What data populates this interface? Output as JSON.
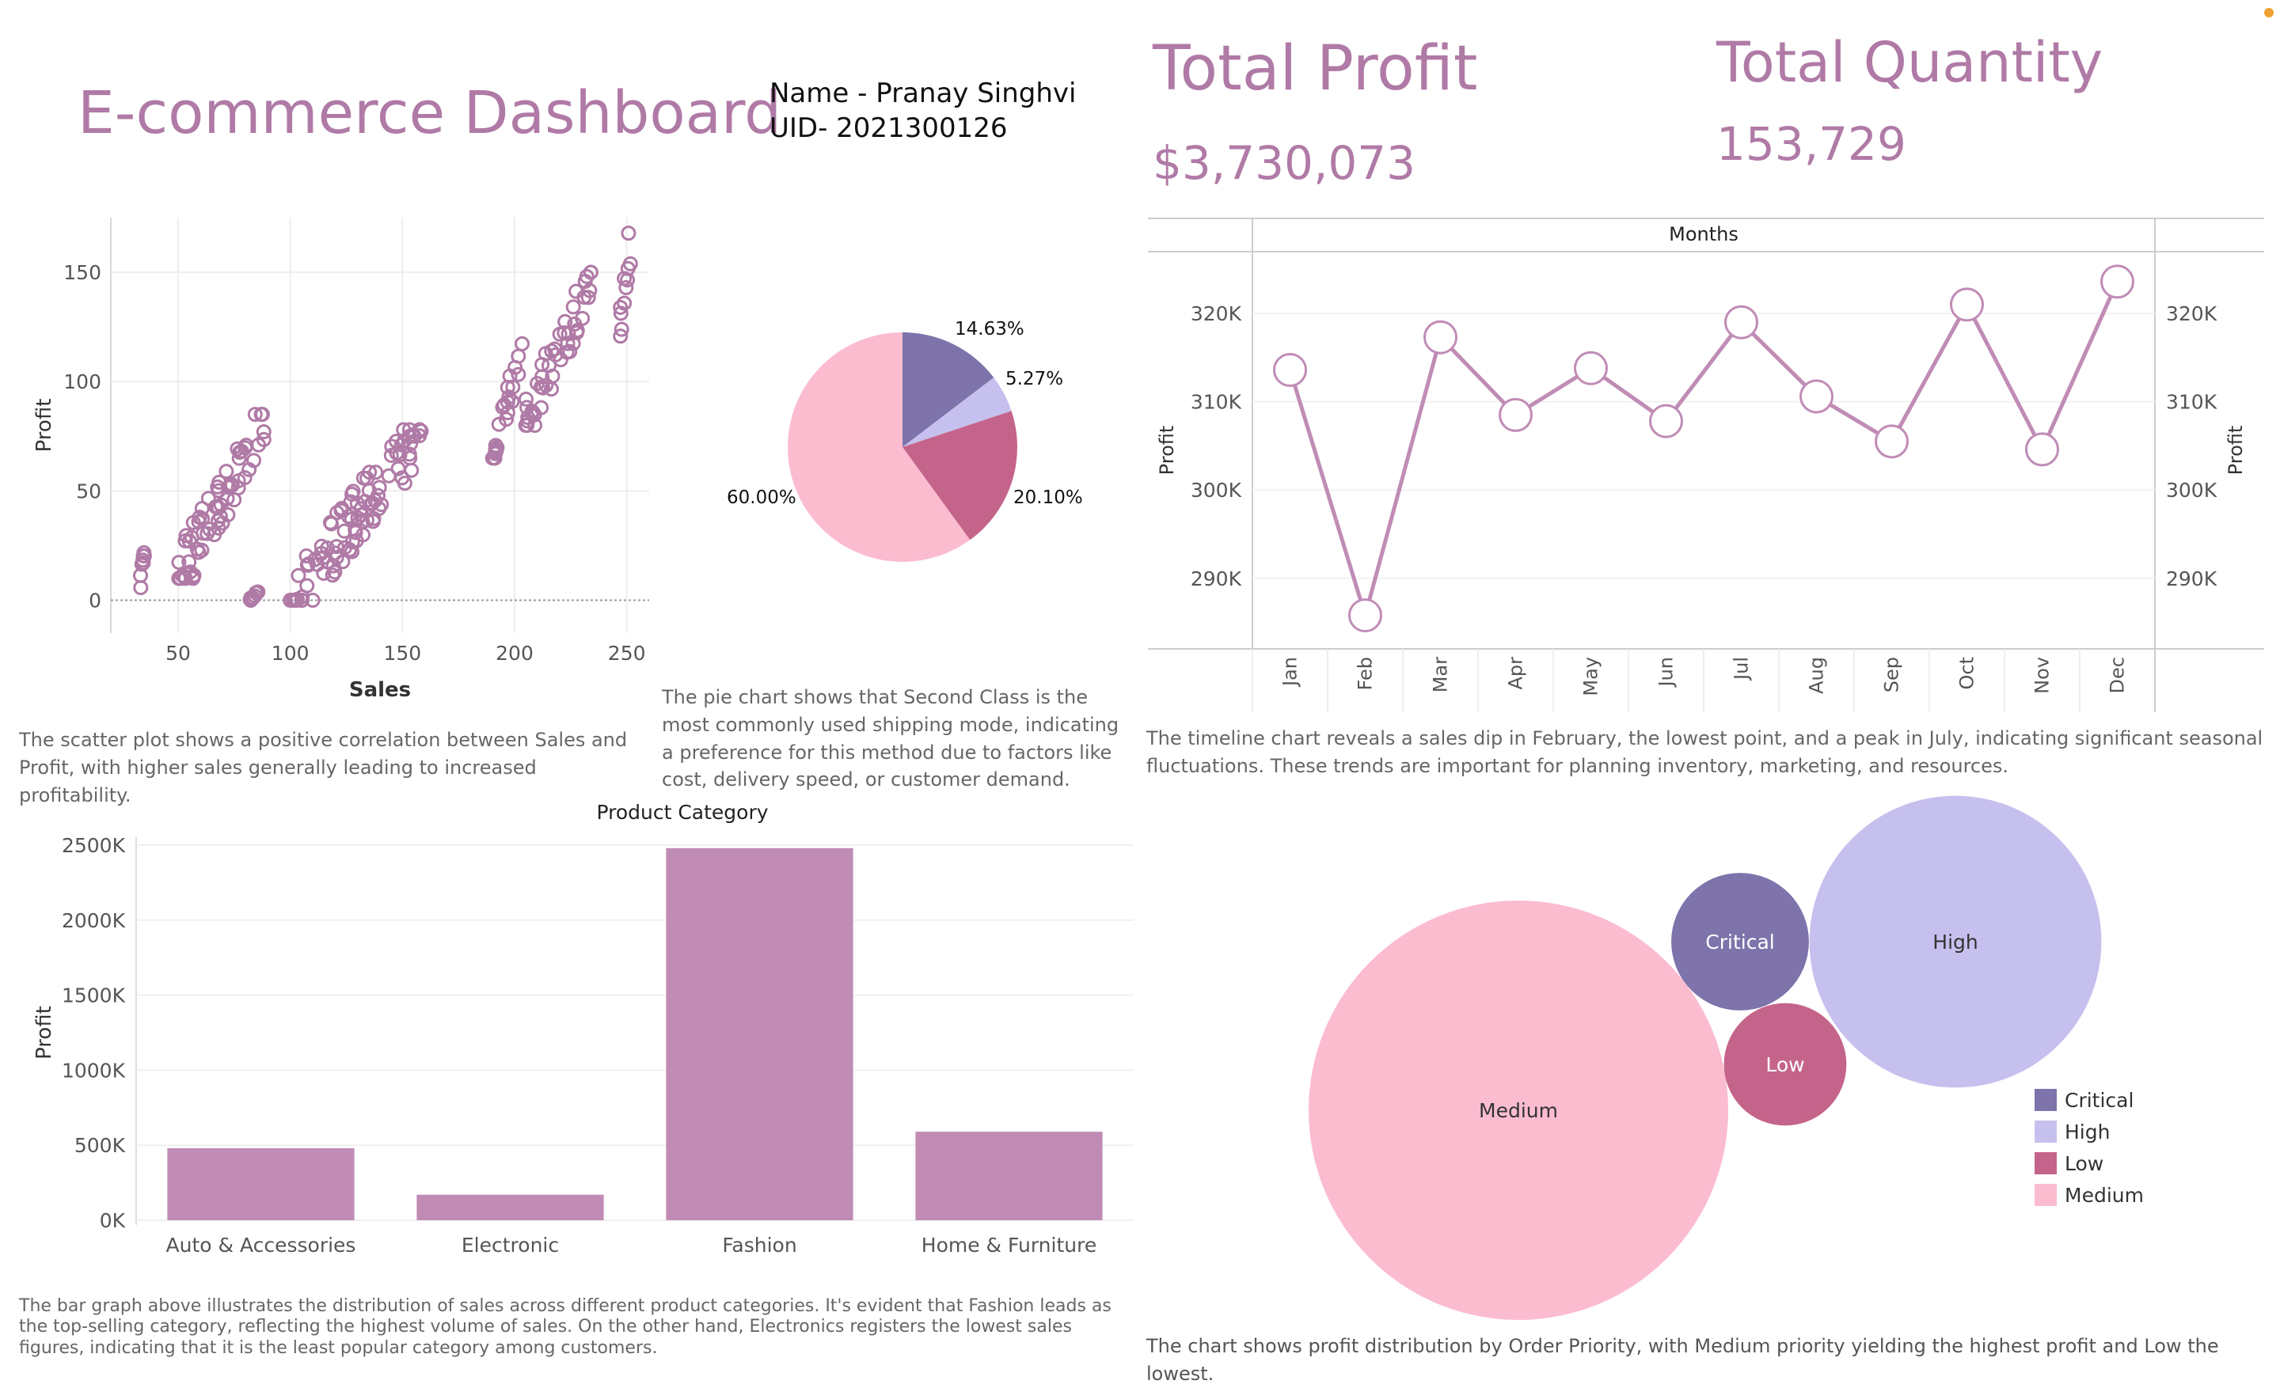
{
  "header": {
    "title": "E-commerce Dashboard",
    "name_line": "Name - Pranay Singhvi",
    "uid_line": "UID- 2021300126"
  },
  "kpis": [
    {
      "label": "Total Profit",
      "value": "$3,730,073"
    },
    {
      "label": "Total Quantity",
      "value": "153,729"
    }
  ],
  "descriptions": {
    "scatter": "The scatter plot shows a positive correlation between Sales and Profit, with higher sales generally leading to increased profitability.",
    "pie": "The pie chart shows that Second Class is the most commonly used shipping mode, indicating a preference for this method due to factors like cost, delivery speed, or customer demand.",
    "line": "The timeline chart reveals a sales dip in February, the lowest point, and a peak in July, indicating significant seasonal fluctuations. These trends are important for planning inventory, marketing, and resources.",
    "bar": "The bar graph above illustrates the distribution of sales across different product categories. It's evident that Fashion leads as the top-selling category, reflecting the highest volume of sales. On the other hand, Electronics registers the lowest sales figures, indicating that it is the least popular category among customers.",
    "bubble": "The chart shows profit distribution by Order Priority, with Medium priority yielding the highest profit and Low the lowest."
  },
  "colors": {
    "accent": "#b07aa6",
    "mark": "#c08cb5",
    "critical": "#7e73ab",
    "high": "#c6c0ee",
    "low": "#c5648a",
    "medium": "#fbbcd0"
  },
  "chart_data": [
    {
      "id": "scatter",
      "type": "scatter",
      "xlabel": "Sales",
      "ylabel": "Profit",
      "xticks": [
        50,
        100,
        150,
        200,
        250
      ],
      "yticks": [
        0,
        50,
        100,
        150
      ],
      "xlim": [
        20,
        260
      ],
      "ylim": [
        -15,
        175
      ],
      "clusters": [
        {
          "x": [
            33,
            36
          ],
          "y": [
            5,
            35
          ]
        },
        {
          "x": [
            50,
            90
          ],
          "y": [
            10,
            85
          ]
        },
        {
          "x": [
            82,
            87
          ],
          "y": [
            0,
            5
          ]
        },
        {
          "x": [
            100,
            160
          ],
          "y": [
            0,
            78
          ]
        },
        {
          "x": [
            190,
            205
          ],
          "y": [
            65,
            120
          ]
        },
        {
          "x": [
            205,
            235
          ],
          "y": [
            80,
            150
          ]
        },
        {
          "x": [
            245,
            252
          ],
          "y": [
            105,
            168
          ]
        }
      ]
    },
    {
      "id": "pie",
      "type": "pie",
      "slices": [
        {
          "label": "14.63%",
          "value": 14.63,
          "color": "#7e73ab"
        },
        {
          "label": "5.27%",
          "value": 5.27,
          "color": "#c6c0ee"
        },
        {
          "label": "20.10%",
          "value": 20.1,
          "color": "#c5648a"
        },
        {
          "label": "60.00%",
          "value": 60.0,
          "color": "#fbbcd0"
        }
      ]
    },
    {
      "id": "line",
      "type": "line",
      "title": "Months",
      "ylabel": "Profit",
      "categories": [
        "Jan",
        "Feb",
        "Mar",
        "Apr",
        "May",
        "Jun",
        "Jul",
        "Aug",
        "Sep",
        "Oct",
        "Nov",
        "Dec"
      ],
      "values": [
        313600,
        285800,
        317300,
        308500,
        313800,
        307800,
        319000,
        310600,
        305500,
        321000,
        304600,
        323600
      ],
      "ylim": [
        282000,
        327000
      ],
      "yticks": [
        290000,
        300000,
        310000,
        320000
      ],
      "ytick_labels": [
        "290K",
        "300K",
        "310K",
        "320K"
      ]
    },
    {
      "id": "bar",
      "type": "bar",
      "title": "Product Category",
      "ylabel": "Profit",
      "categories": [
        "Auto & Accessories",
        "Electronic",
        "Fashion",
        "Home & Furniture"
      ],
      "values": [
        480000,
        170000,
        2480000,
        590000
      ],
      "ylim": [
        0,
        2500000
      ],
      "yticks": [
        0,
        500000,
        1000000,
        1500000,
        2000000,
        2500000
      ],
      "ytick_labels": [
        "0K",
        "500K",
        "1000K",
        "1500K",
        "2000K",
        "2500K"
      ]
    },
    {
      "id": "bubble",
      "type": "bubble",
      "items": [
        {
          "label": "Medium",
          "value": 2230000,
          "color": "#fbbcd0",
          "text_color": "#333333"
        },
        {
          "label": "Critical",
          "value": 240000,
          "color": "#7e73ab",
          "text_color": "#ffffff"
        },
        {
          "label": "High",
          "value": 1080000,
          "color": "#c6c0ee",
          "text_color": "#333333"
        },
        {
          "label": "Low",
          "value": 190000,
          "color": "#c5648a",
          "text_color": "#ffffff"
        }
      ],
      "legend": [
        "Critical",
        "High",
        "Low",
        "Medium"
      ],
      "legend_position": "right"
    }
  ]
}
